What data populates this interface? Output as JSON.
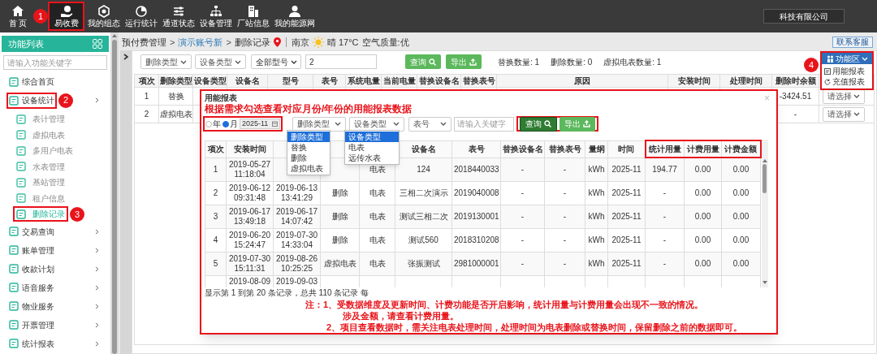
{
  "top_nav": {
    "items": [
      {
        "label": "首 页",
        "selected": false
      },
      {
        "label": "易收费",
        "selected": true,
        "marker": "1"
      },
      {
        "label": "我的组态",
        "selected": false
      },
      {
        "label": "运行统计",
        "selected": false
      },
      {
        "label": "通道状态",
        "selected": false
      },
      {
        "label": "设备管理",
        "selected": false
      },
      {
        "label": "厂站信息",
        "selected": false
      },
      {
        "label": "我的能源网",
        "selected": false
      }
    ],
    "company": "科技有限公司"
  },
  "sidebar": {
    "title": "功能列表",
    "search_placeholder": "请输入功能关键字",
    "items": [
      {
        "label": "综合首页",
        "kind": "link",
        "selected": false
      },
      {
        "label": "设备统计",
        "kind": "group",
        "selected": false,
        "marker": "2",
        "children": [
          {
            "label": "表计管理",
            "selected": false
          },
          {
            "label": "虚拟电表",
            "selected": false
          },
          {
            "label": "多用户电表",
            "selected": false
          },
          {
            "label": "水表管理",
            "selected": false
          },
          {
            "label": "基站管理",
            "selected": false
          },
          {
            "label": "租户信息",
            "selected": false
          },
          {
            "label": "删除记录",
            "selected": true,
            "marker": "3"
          }
        ]
      },
      {
        "label": "交易查询",
        "kind": "group",
        "selected": false
      },
      {
        "label": "账单管理",
        "kind": "group",
        "selected": false
      },
      {
        "label": "收款计划",
        "kind": "group",
        "selected": false
      },
      {
        "label": "语音服务",
        "kind": "group",
        "selected": false
      },
      {
        "label": "物业服务",
        "kind": "group",
        "selected": false
      },
      {
        "label": "开票管理",
        "kind": "group",
        "selected": false
      },
      {
        "label": "统计报表",
        "kind": "group",
        "selected": false
      }
    ]
  },
  "breadcrumb": {
    "items": [
      {
        "label": "预付费管理",
        "link": false
      },
      {
        "label": "演示账号新",
        "link": true
      },
      {
        "label": "删除记录",
        "link": false
      }
    ],
    "separator": ">",
    "city": "南京",
    "weather": "晴 17°C",
    "air_quality": "空气质量:优"
  },
  "support_button": "联系客服",
  "filters": {
    "selects": [
      "删除类型",
      "设备类型"
    ],
    "model_dropdown": "全部型号",
    "search_value": "2",
    "query_button": "查询",
    "export_button": "导出",
    "counts": [
      "替换数量: 1",
      "删除数量: 0",
      "虚拟电表数量: 1"
    ]
  },
  "function_menu": {
    "label": "功能区",
    "marker": "4",
    "items": [
      "用能报表",
      "充值报表"
    ]
  },
  "table": {
    "columns": [
      "项次",
      "删除类型",
      "设备类型",
      "设备名",
      "型号",
      "表号",
      "系统电量",
      "当前电量",
      "替换设备名",
      "替换表号",
      "原因",
      "安装时间",
      "处理时间",
      "删除时余额"
    ],
    "rows": [
      {
        "cells": [
          "1",
          "替换",
          null,
          null,
          null,
          null,
          null,
          null,
          null,
          null,
          null,
          null,
          null,
          "-3424.51"
        ],
        "action": "请选择"
      },
      {
        "cells": [
          "2",
          "虚拟电表",
          null,
          null,
          null,
          null,
          null,
          null,
          null,
          null,
          null,
          null,
          null,
          "-"
        ],
        "action": "请选择"
      }
    ]
  },
  "modal": {
    "title": "用能报表",
    "close": "×",
    "hint": "根据需求勾选查看对应月份/年份的用能报表数据",
    "period": {
      "framed": true,
      "options": [
        {
          "label": "年",
          "selected": false
        },
        {
          "label": "月",
          "selected": true
        }
      ],
      "value": "2025-11"
    },
    "filters": [
      {
        "kind": "select",
        "label": "删除类型"
      },
      {
        "kind": "select",
        "label": "设备类型"
      },
      {
        "kind": "select",
        "label": "表号"
      },
      {
        "kind": "input",
        "placeholder": "请输入关键字"
      }
    ],
    "actions_framed": true,
    "query_button": "查询",
    "export_button": "导出",
    "menus": [
      {
        "items": [
          {
            "label": "删除类型",
            "selected": true
          },
          {
            "label": "替换",
            "selected": false
          },
          {
            "label": "删除",
            "selected": false
          },
          {
            "label": "虚拟电表",
            "selected": false
          }
        ]
      },
      {
        "items": [
          {
            "label": "设备类型",
            "selected": true
          },
          {
            "label": "电表",
            "selected": false
          },
          {
            "label": "远传水表",
            "selected": false
          }
        ]
      }
    ],
    "columns": [
      {
        "label": "项次",
        "framed": false
      },
      {
        "label": "安装时间",
        "framed": false
      },
      null,
      null,
      null,
      {
        "label": "设备名",
        "framed": false
      },
      {
        "label": "表号",
        "framed": false
      },
      {
        "label": "替换设备名",
        "framed": false
      },
      {
        "label": "替换表号",
        "framed": false
      },
      {
        "label": "量纲",
        "framed": false
      },
      {
        "label": "时间",
        "framed": false
      },
      {
        "label": "统计用量",
        "framed": true
      },
      {
        "label": "计费用量",
        "framed": true
      },
      {
        "label": "计费金额",
        "framed": true
      }
    ],
    "rows": [
      [
        "1",
        "2019-05-27 11:18:04",
        null,
        null,
        "电表",
        "124",
        "2018440033",
        "-",
        "-",
        "kWh",
        "2025-11",
        "194.77",
        "0.00",
        "0.00"
      ],
      [
        "2",
        "2019-06-12 09:31:48",
        "2019-06-13 13:41:29",
        "删除",
        "电表",
        "三相二次演示",
        "2019040008",
        "-",
        "-",
        "kWh",
        "2025-11",
        "-",
        "0.00",
        "0.00"
      ],
      [
        "3",
        "2019-06-17 13:49:18",
        "2019-06-17 14:07:42",
        "删除",
        "电表",
        "测试三相二次",
        "2019130001",
        "-",
        "-",
        "kWh",
        "2025-11",
        "-",
        "0.00",
        "0.00"
      ],
      [
        "4",
        "2019-06-20 15:24:47",
        "2019-07-30 14:33:04",
        "删除",
        "电表",
        "测试560",
        "2018310208",
        "-",
        "-",
        "kWh",
        "2025-11",
        "-",
        "0.00",
        "0.00"
      ],
      [
        "5",
        "2019-07-30 15:11:31",
        "2019-08-26 10:25:25",
        "虚拟电表",
        "电表",
        "张振测试",
        "2981000001",
        "-",
        "-",
        "kWh",
        "2025-11",
        "-",
        "0.00",
        "0.00"
      ],
      [
        null,
        "2019-08-09",
        "2019-09-03",
        null,
        null,
        null,
        null,
        null,
        null,
        null,
        null,
        null,
        null,
        null
      ]
    ],
    "footer": "显示第 1 到第 20 条记录，总共 110 条记录 每",
    "notes": [
      "注：1、受数据维度及更新时间、计费功能是否开启影响，统计用量与计费用量会出现不一致的情况。",
      "涉及金额，请查看计费用量。",
      "2、项目查看数据时，需关注电表处理时间，处理时间为电表删除或替换时间，保留删除之前的数据即可。"
    ]
  }
}
